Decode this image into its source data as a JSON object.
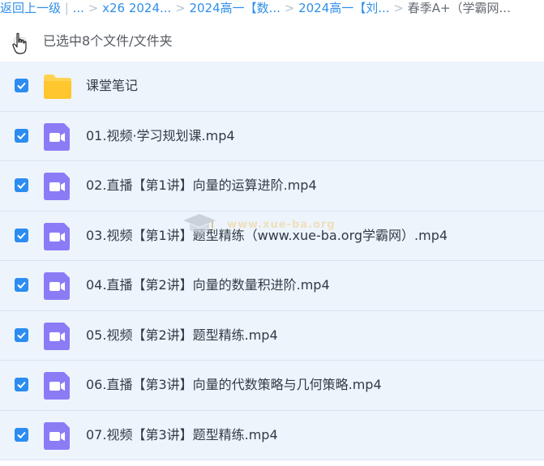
{
  "breadcrumb": {
    "back": "返回上一级",
    "sep": "|",
    "ellipsis": "...",
    "items": [
      "x26 2024...",
      "2024高一【数...",
      "2024高一【刘..."
    ],
    "current": "春季A+（学霸网..."
  },
  "selection": {
    "label": "已选中8个文件/文件夹"
  },
  "files": [
    {
      "name": "课堂笔记",
      "type": "folder",
      "checked": true
    },
    {
      "name": "01.视频·学习规划课.mp4",
      "type": "video",
      "checked": true
    },
    {
      "name": "02.直播【第1讲】向量的运算进阶.mp4",
      "type": "video",
      "checked": true
    },
    {
      "name": "03.视频【第1讲】题型精练（www.xue-ba.org学霸网）.mp4",
      "type": "video",
      "checked": true
    },
    {
      "name": "04.直播【第2讲】向量的数量积进阶.mp4",
      "type": "video",
      "checked": true
    },
    {
      "name": "05.视频【第2讲】题型精练.mp4",
      "type": "video",
      "checked": true
    },
    {
      "name": "06.直播【第3讲】向量的代数策略与几何策略.mp4",
      "type": "video",
      "checked": true
    },
    {
      "name": "07.视频【第3讲】题型精练.mp4",
      "type": "video",
      "checked": true
    }
  ],
  "watermark": {
    "text": "www.xue-ba.org"
  },
  "colors": {
    "accent": "#2c8cf0",
    "link": "#2f8fe8",
    "row_bg": "#edf4fc",
    "folder": "#ffd34f",
    "video": "#8b7cf6"
  }
}
